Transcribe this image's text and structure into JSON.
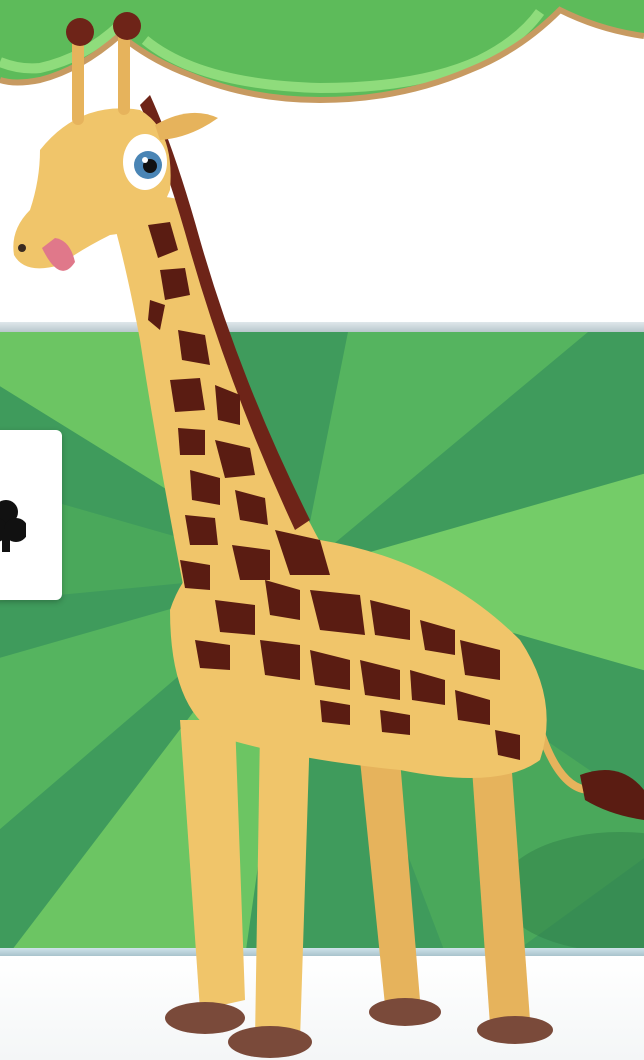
{
  "scene": {
    "character": "giraffe",
    "colors": {
      "wall": "#ffffff",
      "panel_dark": "#3d9a5a",
      "panel_light": "#7ccf6d",
      "curtain_green": "#5fbf5a",
      "curtain_trim": "#b98b55",
      "giraffe_body": "#f0c56a",
      "giraffe_spots": "#5a1c12",
      "mane": "#6e2418",
      "hoof": "#7a4a3a",
      "eye": "#4a85b5"
    },
    "icons": {
      "card_icon": "club-suit-icon",
      "curtain": "curtain-valance-icon"
    }
  }
}
